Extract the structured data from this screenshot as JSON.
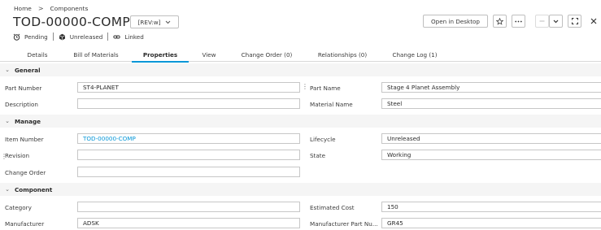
{
  "breadcrumb": {
    "home": "Home",
    "separator": ">",
    "current": "Components"
  },
  "header": {
    "title": "TOD-00000-COMP -",
    "rev_label": "[REV:w]",
    "open_desktop_label": "Open in Desktop"
  },
  "status": {
    "pending": "Pending",
    "unreleased": "Unreleased",
    "linked": "Linked"
  },
  "tabs": [
    {
      "label": "Details"
    },
    {
      "label": "Bill of Materials"
    },
    {
      "label": "Properties"
    },
    {
      "label": "View"
    },
    {
      "label": "Change Order (0)"
    },
    {
      "label": "Relationships (0)"
    },
    {
      "label": "Change Log (1)"
    }
  ],
  "active_tab": "Properties",
  "sections": {
    "general": {
      "title": "General",
      "part_number_label": "Part Number",
      "part_number_value": "ST4-PLANET",
      "part_name_label": "Part Name",
      "part_name_value": "Stage 4 Planet Assembly",
      "description_label": "Description",
      "description_value": "",
      "material_name_label": "Material Name",
      "material_name_value": "Steel"
    },
    "manage": {
      "title": "Manage",
      "item_number_label": "Item Number",
      "item_number_value": "TOD-00000-COMP",
      "lifecycle_label": "Lifecycle",
      "lifecycle_value": "Unreleased",
      "revision_label": "Revision",
      "revision_value": "",
      "state_label": "State",
      "state_value": "Working",
      "change_order_label": "Change Order",
      "change_order_value": ""
    },
    "component": {
      "title": "Component",
      "category_label": "Category",
      "category_value": "",
      "estimated_cost_label": "Estimated Cost",
      "estimated_cost_value": "150",
      "manufacturer_label": "Manufacturer",
      "manufacturer_value": "ADSK",
      "mfr_part_number_label": "Manufacturer Part Nu...",
      "mfr_part_number_value": "GR45"
    }
  },
  "colors": {
    "accent": "#0696d7",
    "section_bg": "#f5f5f5",
    "border": "#c7c7c7"
  }
}
